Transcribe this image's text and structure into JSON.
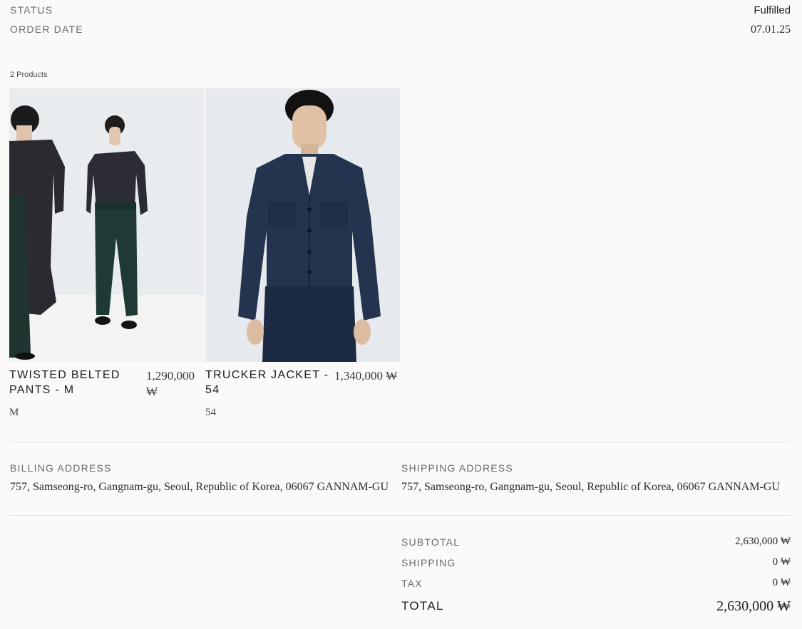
{
  "order": {
    "status_label": "STATUS",
    "status_value": "Fulfilled",
    "date_label": "ORDER DATE",
    "date_value": "07.01.25"
  },
  "products": {
    "count_label": "2 Products",
    "items": [
      {
        "name": "TWISTED BELTED PANTS - M",
        "price": "1,290,000 ₩",
        "variant": "M",
        "image": "model-photo-black-shirt-green-pants"
      },
      {
        "name": "TRUCKER JACKET - 54",
        "price": "1,340,000 ₩",
        "variant": "54",
        "image": "model-photo-denim-jacket"
      }
    ]
  },
  "billing": {
    "label": "BILLING ADDRESS",
    "address": "757, Samseong-ro, Gangnam-gu, Seoul, Republic of Korea, 06067 GANNAM-GU"
  },
  "shipping_address": {
    "label": "SHIPPING ADDRESS",
    "address": "757, Samseong-ro, Gangnam-gu, Seoul, Republic of Korea, 06067 GANNAM-GU"
  },
  "summary": {
    "subtotal_label": "SUBTOTAL",
    "subtotal_value": "2,630,000 ₩",
    "shipping_label": "SHIPPING",
    "shipping_value": "0 ₩",
    "tax_label": "TAX",
    "tax_value": "0 ₩",
    "total_label": "TOTAL",
    "total_value": "2,630,000 ₩"
  },
  "colors": {
    "background": "#fbfaf8",
    "text": "#1d1d1b",
    "muted": "#6a6a66",
    "divider": "#e4e2de"
  }
}
